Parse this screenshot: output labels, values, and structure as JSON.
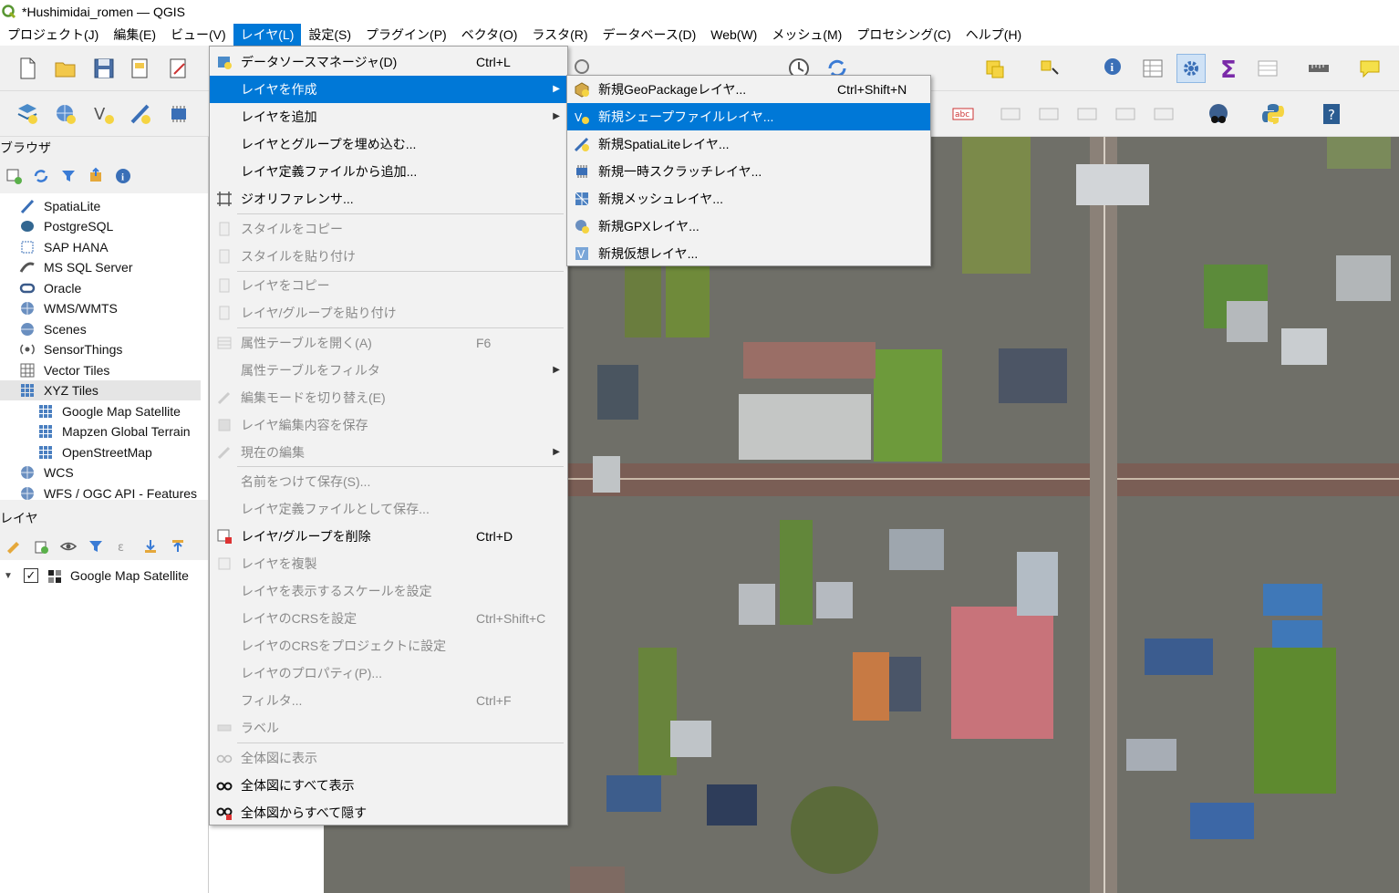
{
  "window": {
    "title": "*Hushimidai_romen — QGIS"
  },
  "menubar": {
    "items": [
      "プロジェクト(J)",
      "編集(E)",
      "ビュー(V)",
      "レイヤ(L)",
      "設定(S)",
      "プラグイン(P)",
      "ベクタ(O)",
      "ラスタ(R)",
      "データベース(D)",
      "Web(W)",
      "メッシュ(M)",
      "プロセシング(C)",
      "ヘルプ(H)"
    ]
  },
  "browser": {
    "title": "ブラウザ",
    "items": [
      "SpatiaLite",
      "PostgreSQL",
      "SAP HANA",
      "MS SQL Server",
      "Oracle",
      "WMS/WMTS",
      "Scenes",
      "SensorThings",
      "Vector Tiles",
      "XYZ Tiles",
      "Google Map Satellite",
      "Mapzen Global Terrain",
      "OpenStreetMap",
      "WCS",
      "WFS / OGC API - Features"
    ]
  },
  "layers": {
    "title": "レイヤ",
    "items": [
      "Google Map Satellite"
    ]
  },
  "layer_menu": {
    "items": [
      {
        "label": "データソースマネージャ(D)",
        "shortcut": "Ctrl+L"
      },
      {
        "label": "レイヤを作成"
      },
      {
        "label": "レイヤを追加"
      },
      {
        "label": "レイヤとグループを埋め込む..."
      },
      {
        "label": "レイヤ定義ファイルから追加..."
      },
      {
        "label": "ジオリファレンサ..."
      },
      {
        "label": "スタイルをコピー"
      },
      {
        "label": "スタイルを貼り付け"
      },
      {
        "label": "レイヤをコピー"
      },
      {
        "label": "レイヤ/グループを貼り付け"
      },
      {
        "label": "属性テーブルを開く(A)",
        "shortcut": "F6"
      },
      {
        "label": "属性テーブルをフィルタ"
      },
      {
        "label": "編集モードを切り替え(E)"
      },
      {
        "label": "レイヤ編集内容を保存"
      },
      {
        "label": "現在の編集"
      },
      {
        "label": "名前をつけて保存(S)..."
      },
      {
        "label": "レイヤ定義ファイルとして保存..."
      },
      {
        "label": "レイヤ/グループを削除",
        "shortcut": "Ctrl+D"
      },
      {
        "label": "レイヤを複製"
      },
      {
        "label": "レイヤを表示するスケールを設定"
      },
      {
        "label": "レイヤのCRSを設定",
        "shortcut": "Ctrl+Shift+C"
      },
      {
        "label": "レイヤのCRSをプロジェクトに設定"
      },
      {
        "label": "レイヤのプロパティ(P)..."
      },
      {
        "label": "フィルタ...",
        "shortcut": "Ctrl+F"
      },
      {
        "label": "ラベル"
      },
      {
        "label": "全体図に表示"
      },
      {
        "label": "全体図にすべて表示"
      },
      {
        "label": "全体図からすべて隠す"
      }
    ]
  },
  "create_submenu": {
    "items": [
      {
        "label": "新規GeoPackageレイヤ...",
        "shortcut": "Ctrl+Shift+N"
      },
      {
        "label": "新規シェープファイルレイヤ..."
      },
      {
        "label": "新規SpatiaLiteレイヤ..."
      },
      {
        "label": "新規一時スクラッチレイヤ..."
      },
      {
        "label": "新規メッシュレイヤ..."
      },
      {
        "label": "新規GPXレイヤ..."
      },
      {
        "label": "新規仮想レイヤ..."
      }
    ]
  },
  "colors": {
    "accent": "#0078d7",
    "menu_bg": "#f2f2f2"
  }
}
